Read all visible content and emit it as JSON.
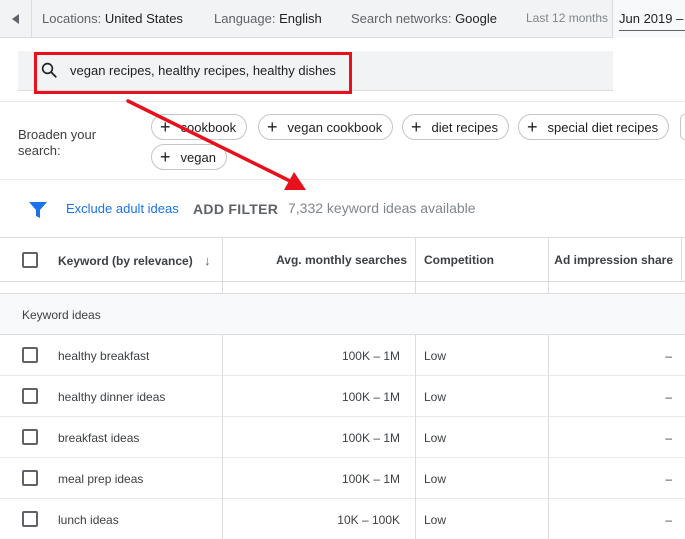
{
  "topbar": {
    "locations_label": "Locations:",
    "locations_value": "United States",
    "language_label": "Language:",
    "language_value": "English",
    "networks_label": "Search networks:",
    "networks_value": "Google",
    "date_range_label": "Last 12 months",
    "date_value": "Jun 2019 –"
  },
  "search": {
    "value": "vegan recipes, healthy recipes, healthy dishes"
  },
  "broaden": {
    "label": "Broaden your search:",
    "chips": [
      "cookbook",
      "vegan cookbook",
      "diet recipes",
      "special diet recipes",
      "vegan"
    ]
  },
  "filterbar": {
    "exclude_label": "Exclude adult ideas",
    "add_filter_label": "ADD FILTER",
    "available_text": "7,332 keyword ideas available"
  },
  "table": {
    "headers": {
      "keyword": "Keyword (by relevance)",
      "sort_icon": "↓",
      "avg_monthly": "Avg. monthly searches",
      "competition": "Competition",
      "ad_impression": "Ad impression share"
    },
    "group_label": "Keyword ideas",
    "rows": [
      {
        "keyword": "healthy breakfast",
        "avg_monthly": "100K – 1M",
        "competition": "Low",
        "ad_impression": "–"
      },
      {
        "keyword": "healthy dinner ideas",
        "avg_monthly": "100K – 1M",
        "competition": "Low",
        "ad_impression": "–"
      },
      {
        "keyword": "breakfast ideas",
        "avg_monthly": "100K – 1M",
        "competition": "Low",
        "ad_impression": "–"
      },
      {
        "keyword": "meal prep ideas",
        "avg_monthly": "100K – 1M",
        "competition": "Low",
        "ad_impression": "–"
      },
      {
        "keyword": "lunch ideas",
        "avg_monthly": "10K – 100K",
        "competition": "Low",
        "ad_impression": "–"
      }
    ]
  },
  "colors": {
    "accent_blue": "#1a73e8",
    "annotation_red": "#e8101b"
  },
  "icons": {
    "back": "chevron-left-icon",
    "search": "search-icon",
    "filter": "filter-icon",
    "chip_add": "plus-icon"
  }
}
